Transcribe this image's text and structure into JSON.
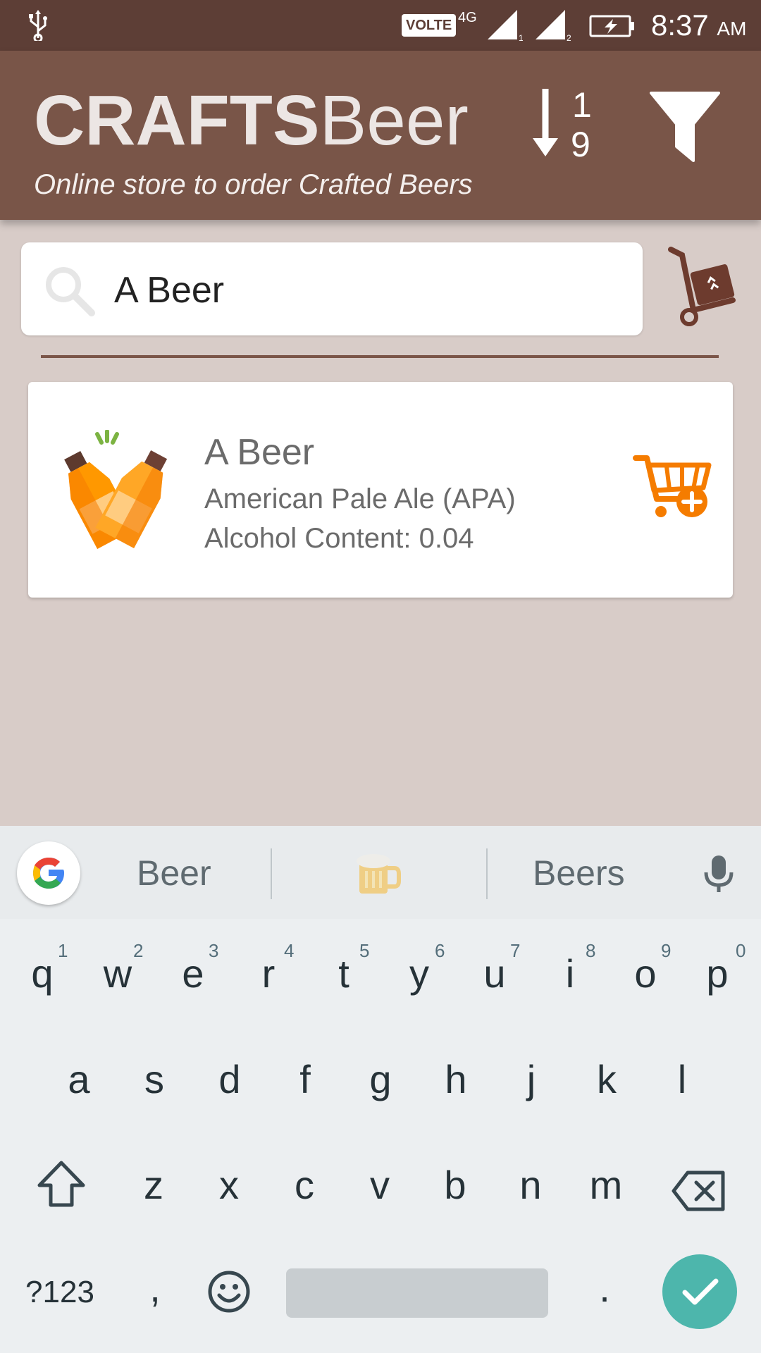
{
  "status_bar": {
    "volte": "VOLTE",
    "network": "4G",
    "time": "8:37",
    "ampm": "AM",
    "icons": [
      "usb-icon",
      "signal-sim1-icon",
      "signal-sim2-icon",
      "battery-charging-icon"
    ]
  },
  "app_bar": {
    "brand_bold": "CRAFTS",
    "brand_regular": "Beer",
    "tagline": "Online store to order Crafted Beers",
    "sort_top": "1",
    "sort_bottom": "9",
    "icons": [
      "sort-numeric-icon",
      "filter-icon"
    ]
  },
  "search": {
    "value": "A Beer",
    "icons": [
      "search-icon",
      "cart-trolley-icon"
    ]
  },
  "results": [
    {
      "name": "A Beer",
      "style": "American Pale Ale (APA)",
      "alcohol": "Alcohol Content: 0.04",
      "icons": [
        "beer-bottles-icon",
        "add-to-cart-icon"
      ]
    }
  ],
  "keyboard": {
    "suggestions": [
      "Beer",
      "Beers"
    ],
    "suggestion_emoji": "beer-mug-emoji",
    "row1": [
      "q",
      "w",
      "e",
      "r",
      "t",
      "y",
      "u",
      "i",
      "o",
      "p"
    ],
    "row1_hints": [
      "1",
      "2",
      "3",
      "4",
      "5",
      "6",
      "7",
      "8",
      "9",
      "0"
    ],
    "row2": [
      "a",
      "s",
      "d",
      "f",
      "g",
      "h",
      "j",
      "k",
      "l"
    ],
    "row3": [
      "z",
      "x",
      "c",
      "v",
      "b",
      "n",
      "m"
    ],
    "symbols_label": "?123",
    "comma": ",",
    "period": ".",
    "icons": [
      "google-icon",
      "microphone-icon",
      "shift-icon",
      "backspace-icon",
      "emoji-icon",
      "done-check-icon"
    ]
  },
  "colors": {
    "status_bar": "#5d3e36",
    "app_bar": "#795548",
    "background": "#d8ccc8",
    "accent_orange": "#f57c00",
    "enter_teal": "#4db6ac"
  }
}
